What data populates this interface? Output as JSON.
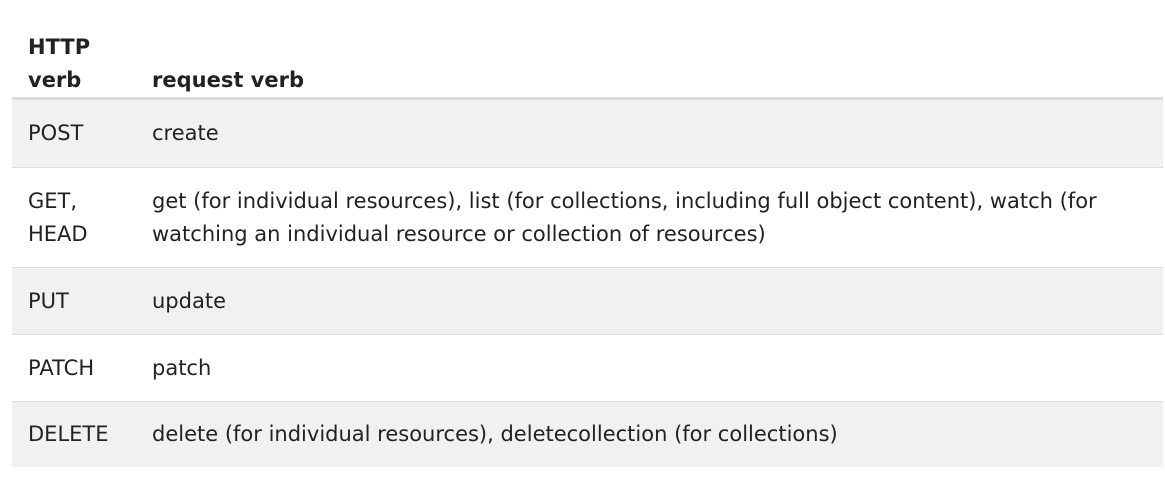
{
  "table": {
    "header": {
      "http_verb_line1": "HTTP",
      "http_verb_line2": "verb",
      "request_verb": "request verb"
    },
    "rows": [
      {
        "http_verb": "POST",
        "request_verb": "create"
      },
      {
        "http_verb_line1": "GET,",
        "http_verb_line2": "HEAD",
        "request_verb": "get (for individual resources), list (for collections, including full object content), watch (for watching an individual resource or collection of resources)"
      },
      {
        "http_verb": "PUT",
        "request_verb": "update"
      },
      {
        "http_verb": "PATCH",
        "request_verb": "patch"
      },
      {
        "http_verb": "DELETE",
        "request_verb": "delete (for individual resources), deletecollection (for collections)"
      }
    ]
  },
  "colors": {
    "row_shade": "#f1f1f1",
    "border": "#dcdde1",
    "text": "#222222"
  }
}
